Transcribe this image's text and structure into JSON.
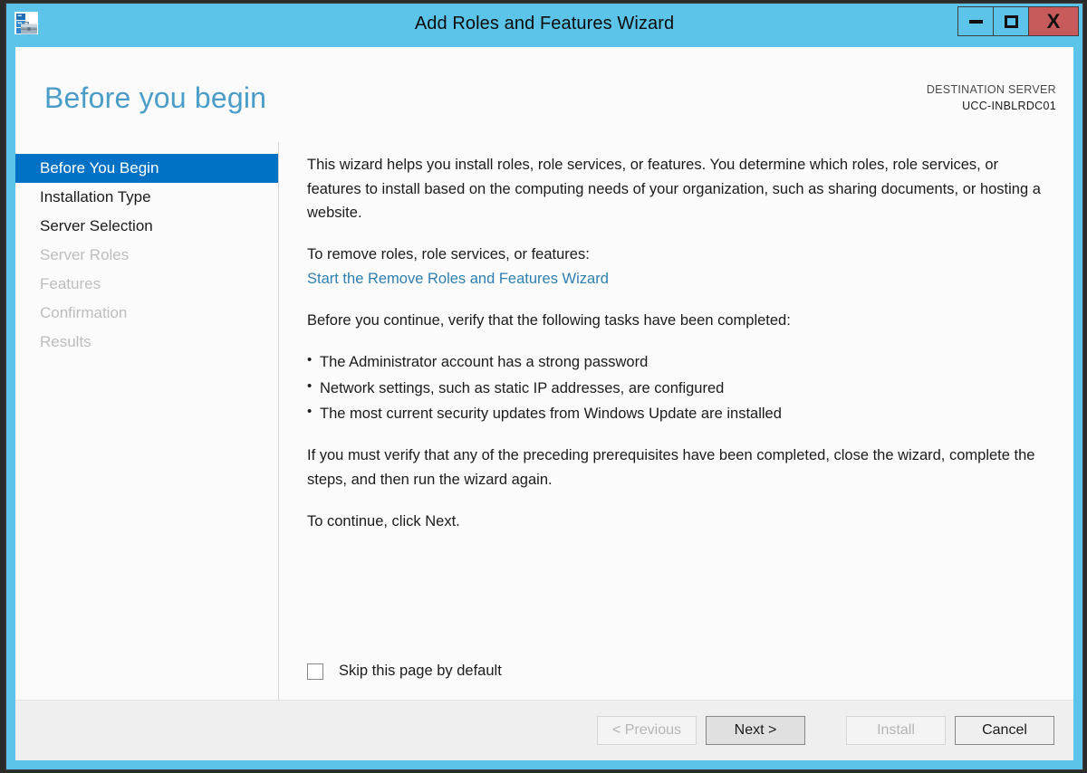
{
  "window": {
    "title": "Add Roles and Features Wizard",
    "app_icon": "server-toolbox-icon",
    "controls": {
      "minimize": "minimize-icon",
      "maximize": "maximize-icon",
      "close": "X"
    },
    "accent_color": "#5bc4e8",
    "close_color": "#c75b5b"
  },
  "header": {
    "page_title": "Before you begin",
    "destination_label": "DESTINATION SERVER",
    "destination_server": "UCC-INBLRDC01",
    "title_color": "#4a9cc9"
  },
  "sidebar": {
    "items": [
      {
        "label": "Before You Begin",
        "state": "selected"
      },
      {
        "label": "Installation Type",
        "state": "enabled"
      },
      {
        "label": "Server Selection",
        "state": "enabled"
      },
      {
        "label": "Server Roles",
        "state": "disabled"
      },
      {
        "label": "Features",
        "state": "disabled"
      },
      {
        "label": "Confirmation",
        "state": "disabled"
      },
      {
        "label": "Results",
        "state": "disabled"
      }
    ],
    "selected_color": "#0072c6"
  },
  "content": {
    "intro": "This wizard helps you install roles, role services, or features. You determine which roles, role services, or features to install based on the computing needs of your organization, such as sharing documents, or hosting a website.",
    "remove_lead": "To remove roles, role services, or features:",
    "remove_link": "Start the Remove Roles and Features Wizard",
    "link_color": "#2e7fb0",
    "verify_lead": "Before you continue, verify that the following tasks have been completed:",
    "tasks": [
      "The Administrator account has a strong password",
      "Network settings, such as static IP addresses, are configured",
      "The most current security updates from Windows Update are installed"
    ],
    "prerequisites_note": "If you must verify that any of the preceding prerequisites have been completed, close the wizard, complete the steps, and then run the wizard again.",
    "continue_note": "To continue, click Next.",
    "skip_checkbox_label": "Skip this page by default",
    "skip_checkbox_checked": false
  },
  "footer": {
    "buttons": [
      {
        "label": "< Previous",
        "state": "disabled"
      },
      {
        "label": "Next >",
        "state": "default"
      },
      {
        "label": "Install",
        "state": "disabled"
      },
      {
        "label": "Cancel",
        "state": "enabled"
      }
    ]
  }
}
